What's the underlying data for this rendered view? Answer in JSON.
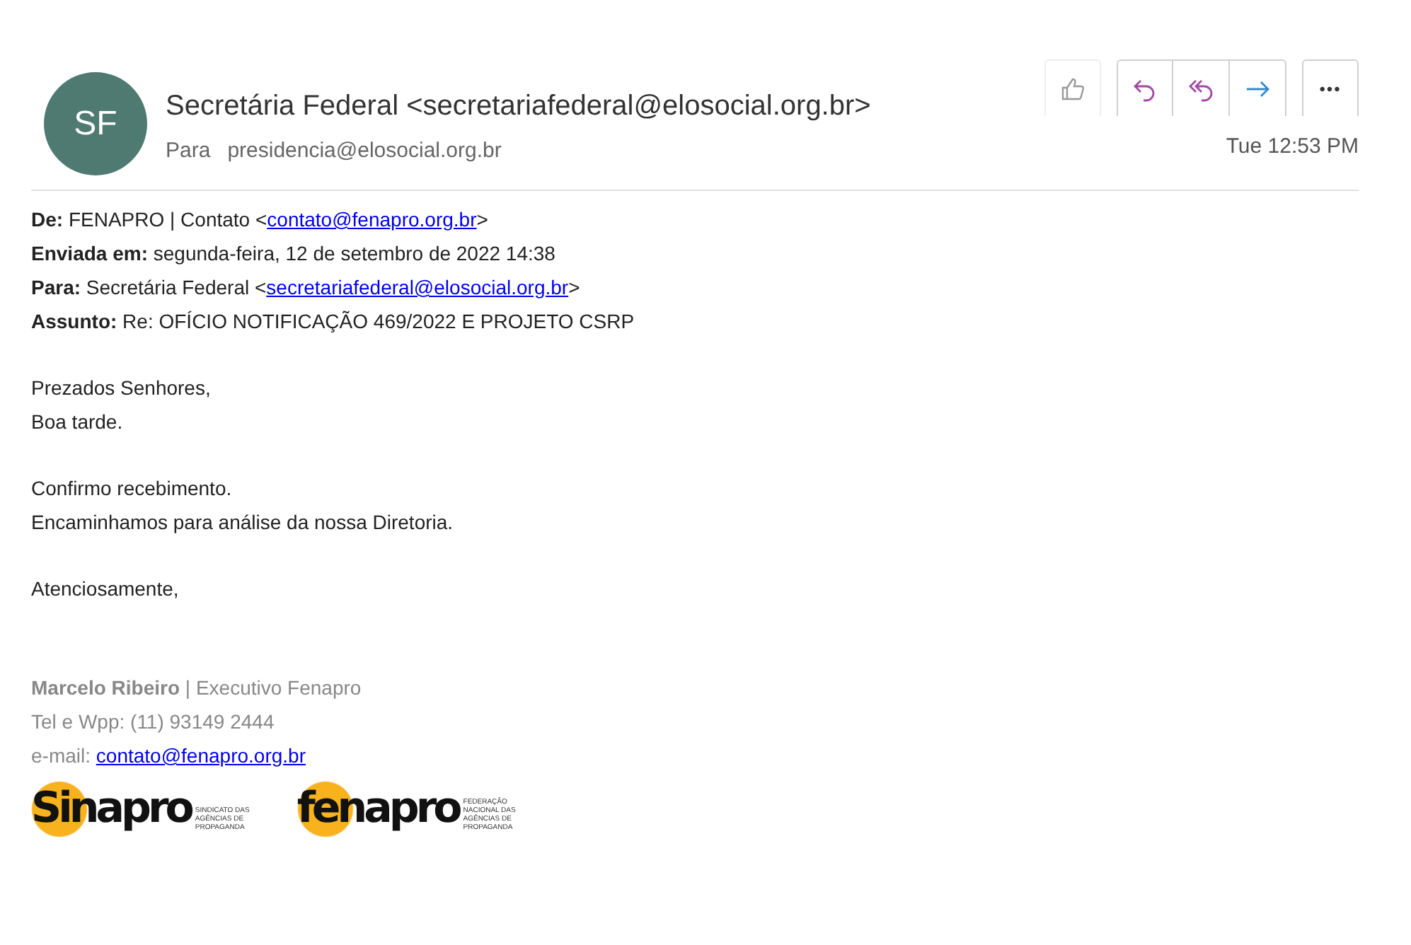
{
  "message": {
    "avatar": "SF",
    "sender": "Secretária Federal <secretariafederal@elosocial.org.br>",
    "to_label": "Para",
    "to": "presidencia@elosocial.org.br",
    "time": "Tue 12:53 PM"
  },
  "toolbar": [
    {
      "kind": "like"
    },
    {
      "kind": "reply"
    },
    {
      "kind": "reply-all"
    },
    {
      "kind": "forward"
    },
    {
      "kind": "more",
      "label": "•••"
    }
  ],
  "header_lines": [
    {
      "label": "De:",
      "text": "FENAPRO | Contato <",
      "link": "contato@fenapro.org.br",
      "suffix": ">"
    },
    {
      "label": "Enviada em:",
      "text": "segunda-feira, 12 de setembro de 2022 14:38"
    },
    {
      "label": "Para:",
      "text": "Secretária Federal <",
      "link": "secretariafederal@elosocial.org.br",
      "suffix": ">"
    },
    {
      "label": "Assunto:",
      "text": "Re: OFÍCIO NOTIFICAÇÃO 469/2022 E PROJETO CSRP"
    }
  ],
  "body": [
    [
      "Prezados Senhores,",
      "Boa tarde."
    ],
    [
      "Confirmo recebimento.",
      "Encaminhamos para análise da nossa Diretoria."
    ],
    [
      "Atenciosamente,"
    ]
  ],
  "signature": {
    "name_line": "**Marcelo Ribeiro** | Executivo Fenapro",
    "phone": "Tel e Wpp: (11) 93149 2444",
    "email_label": "e-mail:",
    "email": "contato@fenapro.org.br"
  },
  "logos": [
    {
      "name": "Sinapro",
      "tagline": "SINDICATO DAS AGÊNCIAS DE PROPAGANDA"
    },
    {
      "name": "fenapro",
      "tagline": "FEDERAÇÃO NACIONAL DAS AGÊNCIAS DE PROPAGANDA"
    }
  ]
}
